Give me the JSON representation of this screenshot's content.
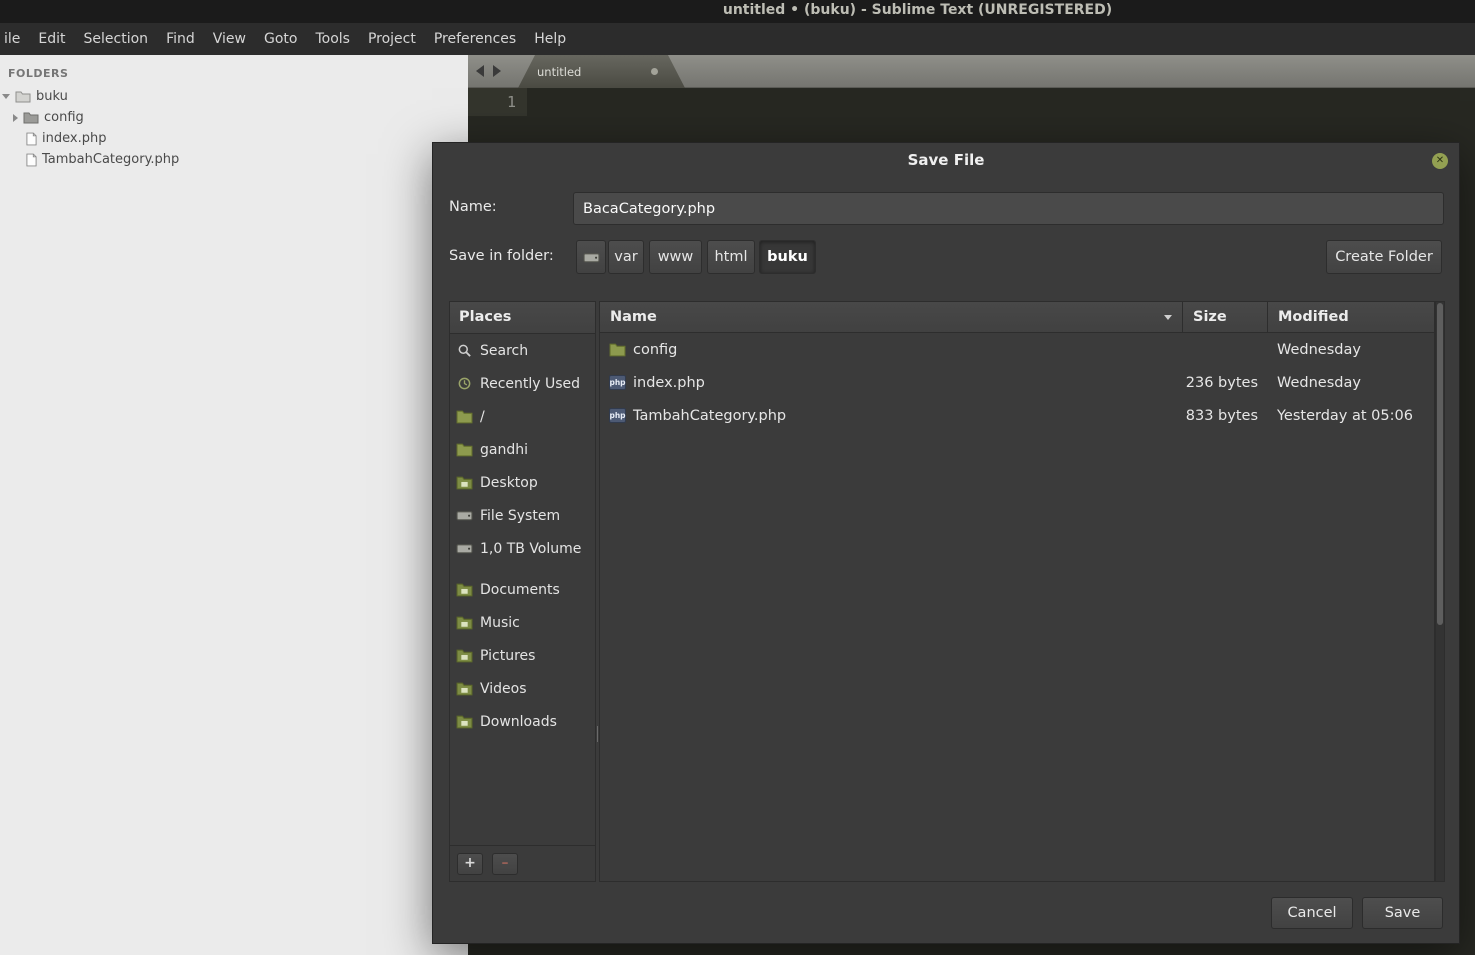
{
  "window": {
    "title": "untitled • (buku) - Sublime Text (UNREGISTERED)"
  },
  "menu": {
    "items": [
      "ile",
      "Edit",
      "Selection",
      "Find",
      "View",
      "Goto",
      "Tools",
      "Project",
      "Preferences",
      "Help"
    ]
  },
  "sidebar": {
    "header": "FOLDERS",
    "items": [
      {
        "label": "buku"
      },
      {
        "label": "config"
      },
      {
        "label": "index.php"
      },
      {
        "label": "TambahCategory.php"
      }
    ]
  },
  "editor": {
    "tab_label": "untitled",
    "line_number": "1"
  },
  "dialog": {
    "title": "Save File",
    "name_label": "Name:",
    "name_value": "BacaCategory.php",
    "save_in_label": "Save in folder:",
    "path": [
      "var",
      "www",
      "html",
      "buku"
    ],
    "create_folder_label": "Create Folder",
    "php_badge": "php",
    "places": {
      "header": "Places",
      "items": [
        {
          "label": "Search"
        },
        {
          "label": "Recently Used"
        },
        {
          "label": "/"
        },
        {
          "label": "gandhi"
        },
        {
          "label": "Desktop"
        },
        {
          "label": "File System"
        },
        {
          "label": "1,0 TB Volume"
        },
        {
          "label": "Documents"
        },
        {
          "label": "Music"
        },
        {
          "label": "Pictures"
        },
        {
          "label": "Videos"
        },
        {
          "label": "Downloads"
        }
      ]
    },
    "list": {
      "columns": {
        "name": "Name",
        "size": "Size",
        "modified": "Modified"
      },
      "rows": [
        {
          "name": "config",
          "size": "",
          "modified": "Wednesday"
        },
        {
          "name": "index.php",
          "size": "236 bytes",
          "modified": "Wednesday"
        },
        {
          "name": "TambahCategory.php",
          "size": "833 bytes",
          "modified": "Yesterday at 05:06"
        }
      ]
    },
    "cancel_label": "Cancel",
    "save_label": "Save"
  }
}
